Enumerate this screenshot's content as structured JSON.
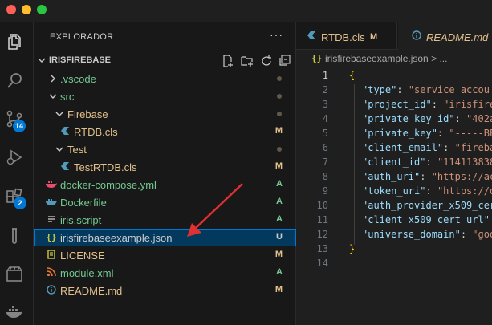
{
  "explorer": {
    "title": "EXPLORADOR",
    "more": "···"
  },
  "project": {
    "name": "IRISFIREBASE"
  },
  "activity": {
    "scm_badge": "14",
    "extensions_badge": "2"
  },
  "tree": [
    {
      "label": ".vscode",
      "status": "",
      "color": "#73c991"
    },
    {
      "label": "src",
      "status": "",
      "color": "#73c991"
    },
    {
      "label": "Firebase",
      "status": "",
      "color": "#e2c08d"
    },
    {
      "label": "RTDB.cls",
      "status": "M",
      "color": "#e2c08d"
    },
    {
      "label": "Test",
      "status": "",
      "color": "#e2c08d"
    },
    {
      "label": "TestRTDB.cls",
      "status": "M",
      "color": "#e2c08d"
    },
    {
      "label": "docker-compose.yml",
      "status": "A",
      "color": "#73c991"
    },
    {
      "label": "Dockerfile",
      "status": "A",
      "color": "#73c991"
    },
    {
      "label": "iris.script",
      "status": "A",
      "color": "#73c991"
    },
    {
      "label": "irisfirebaseexample.json",
      "status": "U",
      "color": "#cccccc"
    },
    {
      "label": "LICENSE",
      "status": "M",
      "color": "#e2c08d"
    },
    {
      "label": "module.xml",
      "status": "A",
      "color": "#73c991"
    },
    {
      "label": "README.md",
      "status": "M",
      "color": "#e2c08d"
    }
  ],
  "tabs": [
    {
      "label": "RTDB.cls",
      "status": "M"
    },
    {
      "label": "README.md"
    }
  ],
  "breadcrumb": {
    "file": "irisfirebaseexample.json",
    "separator": ">",
    "more": "..."
  },
  "code": {
    "line_numbers": [
      "1",
      "2",
      "3",
      "4",
      "5",
      "6",
      "7",
      "8",
      "9",
      "10",
      "11",
      "12",
      "13",
      "14"
    ],
    "lines": [
      {
        "k": "",
        "v": "{"
      },
      {
        "k": "\"type\"",
        "v": "\"service_accou"
      },
      {
        "k": "\"project_id\"",
        "v": "\"irisfire"
      },
      {
        "k": "\"private_key_id\"",
        "v": "\"402a"
      },
      {
        "k": "\"private_key\"",
        "v": "\"-----BE"
      },
      {
        "k": "\"client_email\"",
        "v": "\"fireba"
      },
      {
        "k": "\"client_id\"",
        "v": "\"114113838"
      },
      {
        "k": "\"auth_uri\"",
        "v": "\"https://ac"
      },
      {
        "k": "\"token_uri\"",
        "v": "\"https://o"
      },
      {
        "k": "\"auth_provider_x509_cer",
        "v": ""
      },
      {
        "k": "\"client_x509_cert_url\"",
        "v": ""
      },
      {
        "k": "\"universe_domain\"",
        "v": "\"goo"
      },
      {
        "k": "",
        "v": "}"
      },
      {
        "k": "",
        "v": ""
      }
    ]
  },
  "colors": {
    "accent": "#0078d4",
    "modified": "#e2c08d",
    "added": "#73c991",
    "arrow": "#e03030"
  }
}
